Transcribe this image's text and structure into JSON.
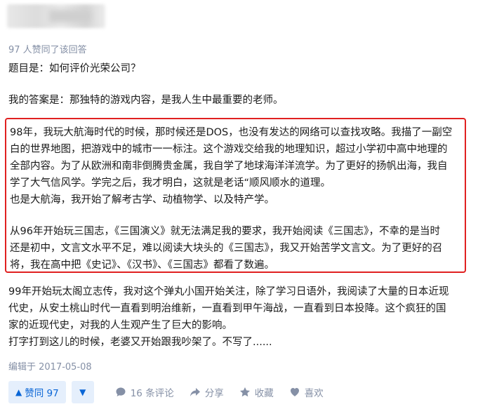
{
  "votes_text": "97 人赞同了该回答",
  "question_line": "题目是：如何评价光荣公司？",
  "answer_line": "我的答案是：那独特的游戏内容，是我人生中最重要的老师。",
  "highlight_lines": [
    "98年，我玩大航海时代的时候，那时候还是DOS，也没有发达的网络可以查找攻略。我描了一副空",
    "白的世界地图，把游戏中的城市一一标注。这个游戏交给我的地理知识，超过小学初中高中地理的",
    "全部内容。为了从欧洲和南非倒腾贵金属，我自学了地球海洋洋流学。为了更好的扬帆出海，我自",
    "学了大气信风学。学完之后，我才明白，这就是老话“顺风顺水的道理。",
    "也是大航海，我开始了解考古学、动植物学、以及特产学。",
    "从96年开始玩三国志，《三国演义》就无法满足我的要求，我开始阅读《三国志》，不幸的是当时",
    "还是初中，文言文水平不足，难以阅读大块头的《三国志》，我又开始苦学文言文。为了更好的召",
    "将，我在高中把《史记》、《汉书》、《三国志》都看了数遍。"
  ],
  "after_lines": [
    "99年开始玩太阁立志传，我对这个弹丸小国开始关注，除了学习日语外，我阅读了大量的日本近现",
    "代史，从安土桃山时代一直看到明治维新，一直看到甲午海战，一直看到日本投降。这个疯狂的国",
    "家的近现代史，对我的人生观产生了巨大的影响。",
    "打字打到这儿的时候，老婆又开始跟我吵架了。不写了......"
  ],
  "edited_text": "编辑于 2017-05-08",
  "actions": {
    "upvote_label": "赞同 97",
    "upvote_icon": "triangle-up-icon",
    "downvote_icon": "triangle-down-icon",
    "comments_label": "16 条评论",
    "share_label": "分享",
    "favorite_label": "收藏",
    "like_label": "喜欢",
    "accent_color": "#0a66d6",
    "muted_color": "#8590a6",
    "highlight_border_color": "#e02020"
  }
}
